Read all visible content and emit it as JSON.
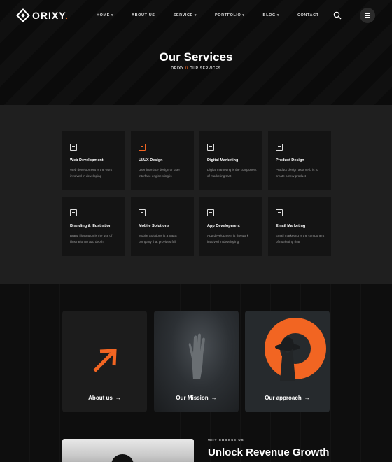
{
  "brand": {
    "name": "ORIXY",
    "dot": ".",
    "accent": "#f26522"
  },
  "nav": [
    {
      "label": "HOME",
      "has_dropdown": true
    },
    {
      "label": "ABOUT US",
      "has_dropdown": false
    },
    {
      "label": "SERVICE",
      "has_dropdown": true
    },
    {
      "label": "PORTFOLIO",
      "has_dropdown": true
    },
    {
      "label": "BLOG",
      "has_dropdown": true
    },
    {
      "label": "CONTACT",
      "has_dropdown": false
    }
  ],
  "hero": {
    "title": "Our Services",
    "breadcrumb": {
      "home": "ORIXY",
      "separator": "//",
      "current": "OUR SERVICES"
    }
  },
  "services": [
    {
      "icon": "code-window-icon",
      "title": "Web Development",
      "desc": "Web development is the work involved in developing"
    },
    {
      "icon": "ui-window-icon",
      "title": "UI/UX Design",
      "desc": "User interface design or user interface engineering is"
    },
    {
      "icon": "marketing-icon",
      "title": "Digital Marketing",
      "desc": "Digital marketing is the component of marketing that"
    },
    {
      "icon": "monitor-icon",
      "title": "Product Design",
      "desc": "Product design as a verb is to create a new product"
    },
    {
      "icon": "document-icon",
      "title": "Branding & Illustration",
      "desc": "Brand illustration is the use of illustration to add depth"
    },
    {
      "icon": "monitor-gear-icon",
      "title": "Mobile Solutions",
      "desc": "Mobile Solutions is a SaaS company that provides full"
    },
    {
      "icon": "app-icon",
      "title": "App Development",
      "desc": "App development is the work involved in developing"
    },
    {
      "icon": "email-icon",
      "title": "Email Marketing",
      "desc": "Email marketing is the component of marketing that"
    }
  ],
  "panels": [
    {
      "label": "About us",
      "arrow": "→"
    },
    {
      "label": "Our Mission",
      "arrow": "→"
    },
    {
      "label": "Our approach",
      "arrow": "→"
    }
  ],
  "why": {
    "eyebrow": "WHY CHOOSE US",
    "headline": "Unlock Revenue Growth"
  }
}
